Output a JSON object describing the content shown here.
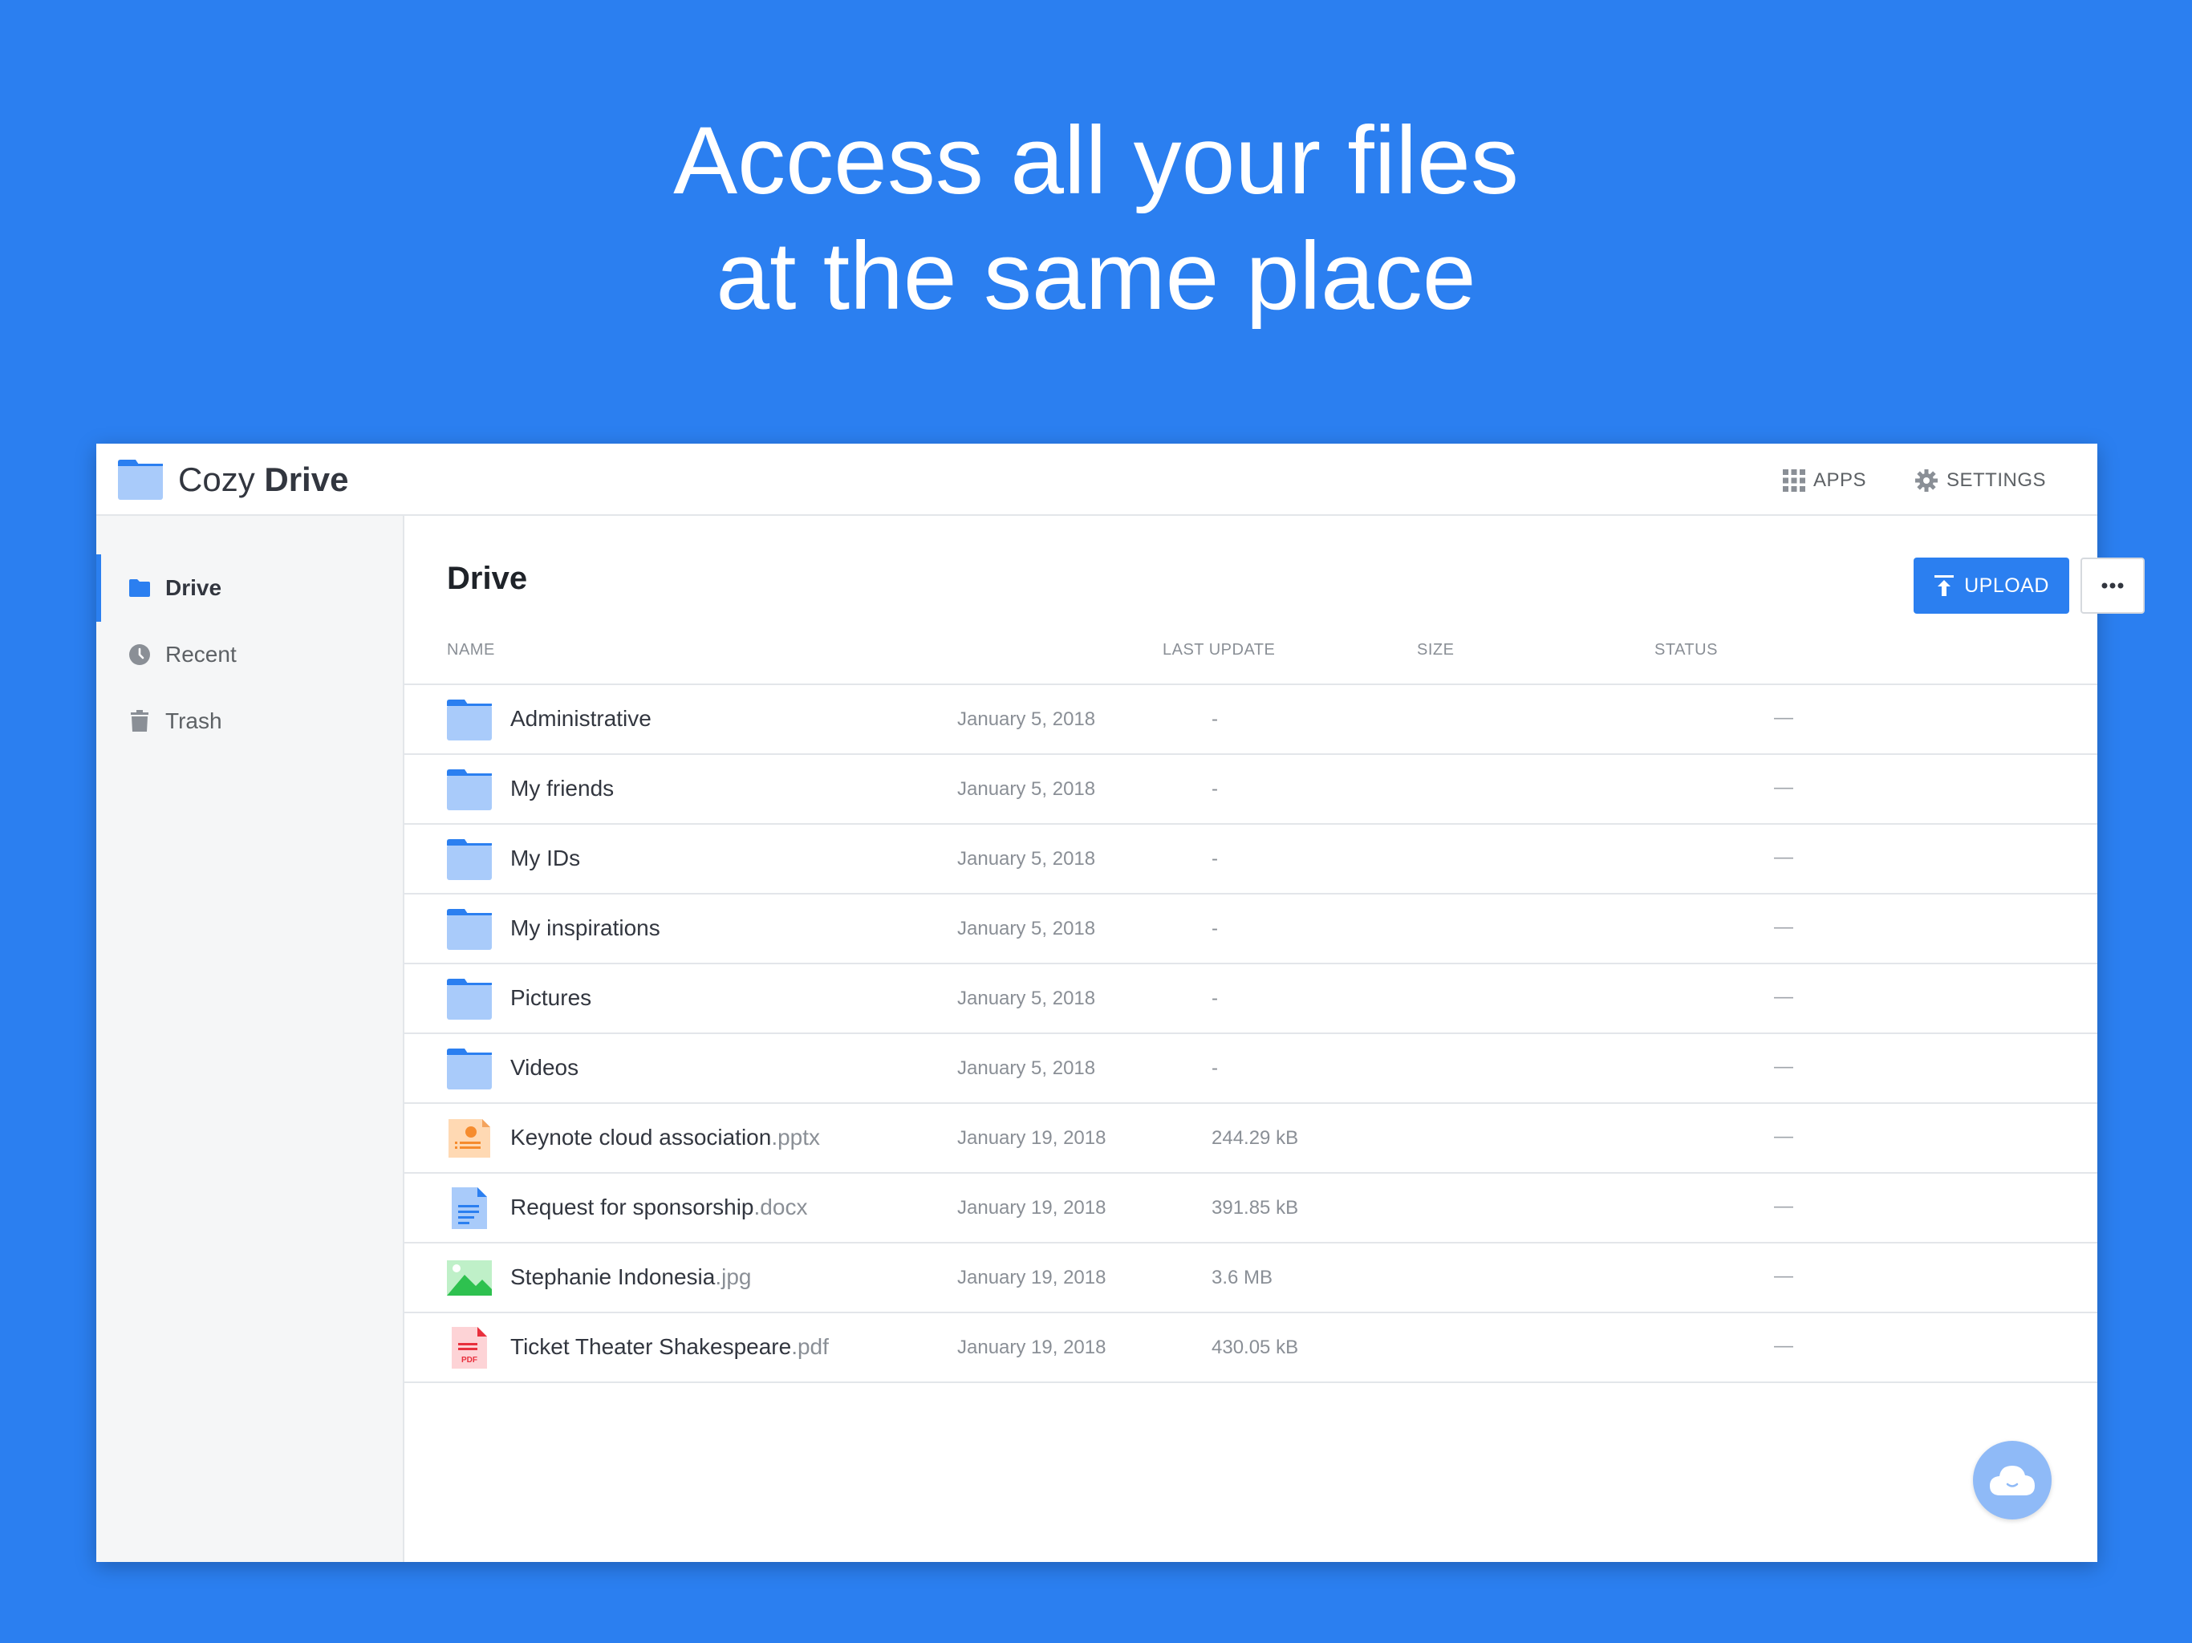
{
  "headline": {
    "line1": "Access all your files",
    "line2": "at the same place"
  },
  "app": {
    "brand_light": "Cozy",
    "brand_bold": "Drive",
    "apps_label": "APPS",
    "settings_label": "SETTINGS"
  },
  "sidebar": {
    "items": [
      {
        "label": "Drive",
        "icon": "folder-icon",
        "active": true
      },
      {
        "label": "Recent",
        "icon": "clock-icon"
      },
      {
        "label": "Trash",
        "icon": "trash-icon"
      }
    ]
  },
  "main": {
    "title": "Drive",
    "upload_label": "UPLOAD",
    "more_label": "•••",
    "columns": [
      "NAME",
      "LAST UPDATE",
      "SIZE",
      "STATUS"
    ]
  },
  "files": [
    {
      "name": "Administrative",
      "ext": "",
      "type": "folder",
      "date": "January 5, 2018",
      "size": "-",
      "status": "—"
    },
    {
      "name": "My friends",
      "ext": "",
      "type": "folder",
      "date": "January 5, 2018",
      "size": "-",
      "status": "—"
    },
    {
      "name": "My IDs",
      "ext": "",
      "type": "folder",
      "date": "January 5, 2018",
      "size": "-",
      "status": "—"
    },
    {
      "name": "My inspirations",
      "ext": "",
      "type": "folder",
      "date": "January 5, 2018",
      "size": "-",
      "status": "—"
    },
    {
      "name": "Pictures",
      "ext": "",
      "type": "folder",
      "date": "January 5, 2018",
      "size": "-",
      "status": "—"
    },
    {
      "name": "Videos",
      "ext": "",
      "type": "folder",
      "date": "January 5, 2018",
      "size": "-",
      "status": "—"
    },
    {
      "name": "Keynote cloud association",
      "ext": ".pptx",
      "type": "slides",
      "date": "January 19, 2018",
      "size": "244.29 kB",
      "status": "—"
    },
    {
      "name": "Request for sponsorship",
      "ext": ".docx",
      "type": "text",
      "date": "January 19, 2018",
      "size": "391.85 kB",
      "status": "—"
    },
    {
      "name": "Stephanie Indonesia",
      "ext": ".jpg",
      "type": "image",
      "date": "January 19, 2018",
      "size": "3.6 MB",
      "status": "—"
    },
    {
      "name": "Ticket Theater Shakespeare",
      "ext": ".pdf",
      "type": "pdf",
      "date": "January 19, 2018",
      "size": "430.05 kB",
      "status": "—"
    }
  ],
  "colors": {
    "background": "#2b7ff0",
    "accent": "#2b7ff0",
    "folder": "#a9cbfa"
  }
}
